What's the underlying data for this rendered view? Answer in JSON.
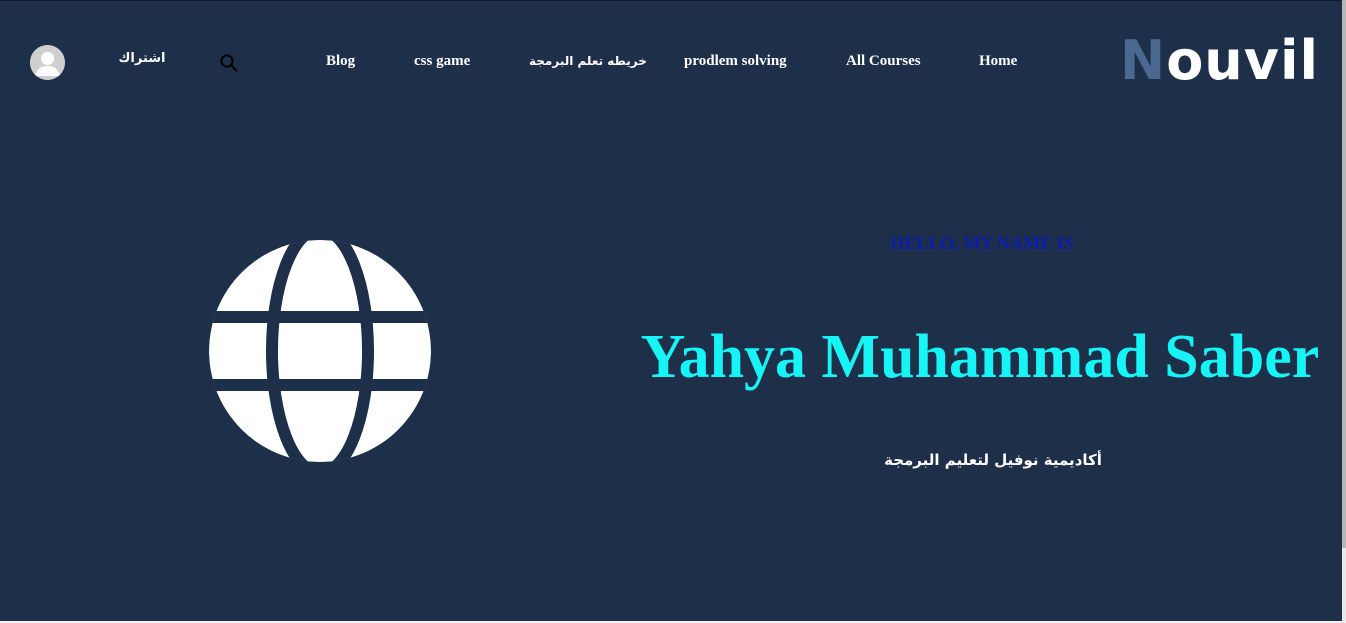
{
  "header": {
    "logo": {
      "first_letter": "N",
      "rest": "ouvil"
    },
    "signup_label": "اشتراك",
    "nav": [
      {
        "label": "Home"
      },
      {
        "label": "All Courses"
      },
      {
        "label": "prodlem solving"
      },
      {
        "label": "خريطه تعلم البرمجة"
      },
      {
        "label": "css game"
      },
      {
        "label": "Blog"
      }
    ],
    "icons": {
      "search": "search-icon",
      "avatar": "user-avatar-icon"
    }
  },
  "hero": {
    "greeting": "HELLO, MY NAME IS",
    "name": "Yahya Muhammad Saber",
    "tagline": "أكاديمية نوفيل لتعليم البرمجة",
    "image_icon": "globe-icon"
  },
  "colors": {
    "background": "#1e2f49",
    "logo_accent": "#4b6891",
    "name": "#17f4f6",
    "greeting": "#0c1cb0",
    "text": "#ffffff"
  }
}
